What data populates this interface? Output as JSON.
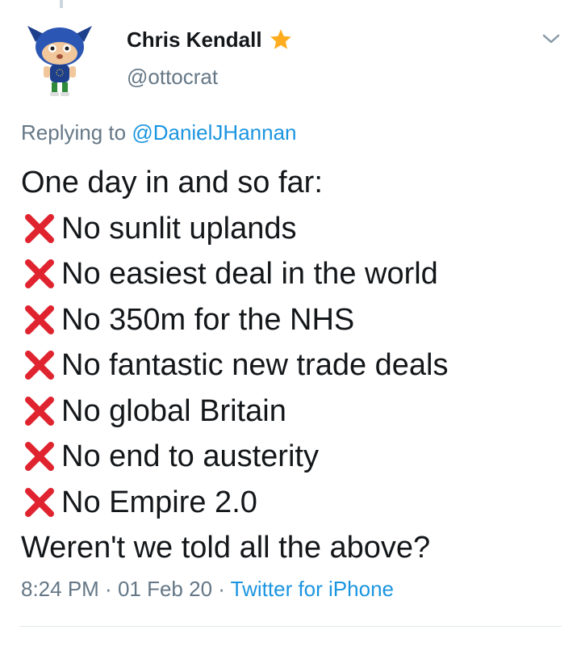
{
  "tweet": {
    "author": {
      "display_name": "Chris Kendall",
      "handle": "@ottocrat",
      "badge_icon": "star-icon",
      "avatar_icon": "animal-crossing-villager-avatar"
    },
    "replying_prefix": "Replying to ",
    "replying_to": "@DanielJHannan",
    "intro": "One day in and so far:",
    "items": [
      "No sunlit uplands",
      "No easiest deal in the world",
      "No 350m for the NHS",
      "No fantastic new trade deals",
      "No global Britain",
      "No end to austerity",
      "No Empire 2.0"
    ],
    "item_icon": "red-cross-mark-icon",
    "closing": "Weren't we told all the above?",
    "time": "8:24 PM",
    "date": "01 Feb 20",
    "separator": " · ",
    "source": "Twitter for iPhone",
    "menu_icon": "chevron-down-icon"
  },
  "colors": {
    "text": "#14171a",
    "secondary": "#657786",
    "link": "#1b95e0",
    "cross": "#e0242f",
    "star": "#ffad1f",
    "divider": "#e1e8ed"
  }
}
